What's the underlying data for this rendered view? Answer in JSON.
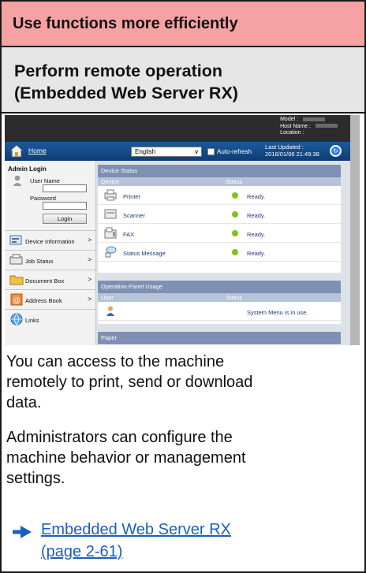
{
  "header": {
    "title": "Use functions more efficiently"
  },
  "section": {
    "title_line1": "Perform remote operation",
    "title_line2": "(Embedded Web Server RX)"
  },
  "screenshot": {
    "model_lines": [
      "Model :",
      "Host Name :",
      "Location :"
    ],
    "nav": {
      "home": "Home",
      "language": "English",
      "auto_refresh": "Auto-refresh",
      "last_updated_label": "Last Updated :",
      "last_updated_value": "2016/01/06 21:49:38"
    },
    "login": {
      "title": "Admin Login",
      "user_label": "User Name",
      "password_label": "Password",
      "button": "Login"
    },
    "menu": [
      {
        "label": "Device Information",
        "chevron": ">"
      },
      {
        "label": "Job Status",
        "chevron": ">"
      },
      {
        "label": "Document Box",
        "chevron": ">"
      },
      {
        "label": "Address Book",
        "chevron": ">"
      },
      {
        "label": "Links",
        "chevron": ""
      }
    ],
    "device_status": {
      "title": "Device Status",
      "col_device": "Device",
      "col_status": "Status",
      "rows": [
        {
          "device": "Printer",
          "status": "Ready."
        },
        {
          "device": "Scanner",
          "status": "Ready."
        },
        {
          "device": "FAX",
          "status": "Ready."
        },
        {
          "device": "Status Message",
          "status": "Ready."
        }
      ],
      "status_color": "#7fc31c"
    },
    "panel_usage": {
      "title": "Operation Panel Usage",
      "col_user": "User",
      "col_status": "Status",
      "status": "System Menu is in use."
    },
    "paper": {
      "title": "Paper"
    }
  },
  "body": {
    "para1": [
      "You can access to the machine",
      "remotely to print, send or download",
      "data."
    ],
    "para2": [
      "Administrators can configure the",
      "machine behavior or management",
      "settings."
    ],
    "link_line1": "Embedded Web Server RX",
    "link_line2": "(page 2-61)"
  },
  "colors": {
    "header_bg": "#f7a2a2",
    "subheader_bg": "#e6e6e6",
    "link": "#1a5fc2",
    "nav_bg": "#1c5b9b"
  }
}
